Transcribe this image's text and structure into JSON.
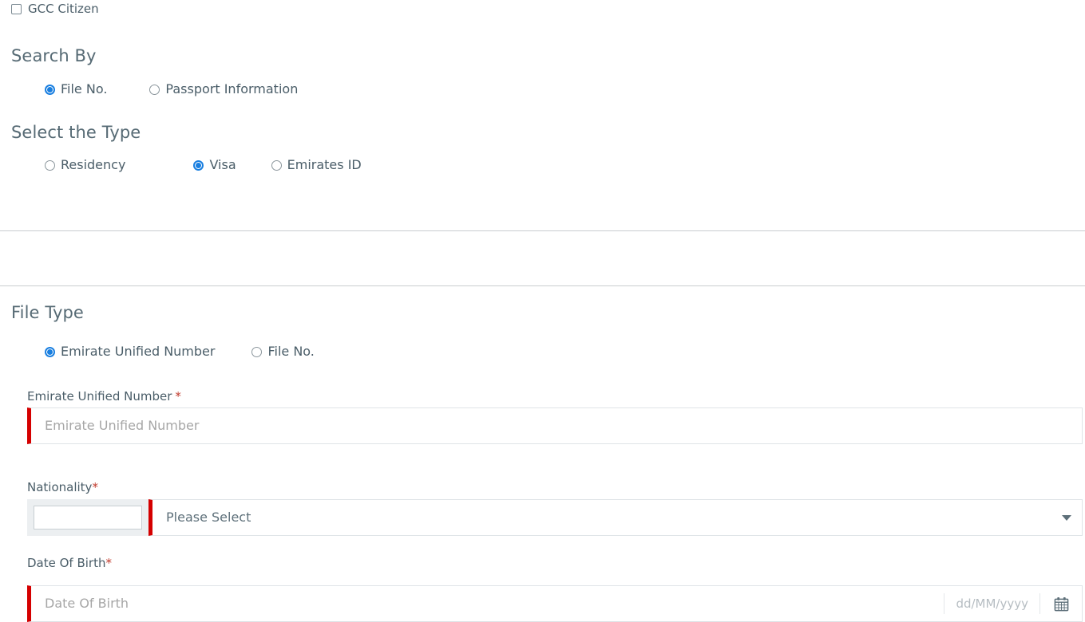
{
  "gcc": {
    "checkbox_label": "GCC Citizen",
    "checked": false
  },
  "search_by": {
    "heading": "Search By",
    "options": [
      {
        "label": "File No.",
        "selected": true
      },
      {
        "label": "Passport Information",
        "selected": false
      }
    ]
  },
  "select_type": {
    "heading": "Select the Type",
    "options": [
      {
        "label": "Residency",
        "selected": false
      },
      {
        "label": "Visa",
        "selected": true
      },
      {
        "label": "Emirates ID",
        "selected": false
      }
    ]
  },
  "file_type": {
    "heading": "File Type",
    "options": [
      {
        "label": "Emirate Unified Number",
        "selected": true
      },
      {
        "label": "File No.",
        "selected": false
      }
    ]
  },
  "fields": {
    "unified_number": {
      "label": "Emirate Unified Number",
      "required_marker": "*",
      "placeholder": "Emirate Unified Number",
      "value": ""
    },
    "nationality": {
      "label": "Nationality",
      "required_marker": "*",
      "selected_option": "Please Select",
      "search_value": "",
      "caret_icon": "chevron-down-icon"
    },
    "date_of_birth": {
      "label": "Date Of Birth",
      "required_marker": "*",
      "placeholder": "Date Of Birth",
      "value": "",
      "format_hint": "dd/MM/yyyy",
      "calendar_icon": "calendar-icon"
    }
  },
  "colors": {
    "accent_blue": "#1a7fe0",
    "required_red": "#c0392b",
    "error_bar_red": "#d50000",
    "heading_slate": "#566a74",
    "divider_gray": "#c9cdd0"
  }
}
